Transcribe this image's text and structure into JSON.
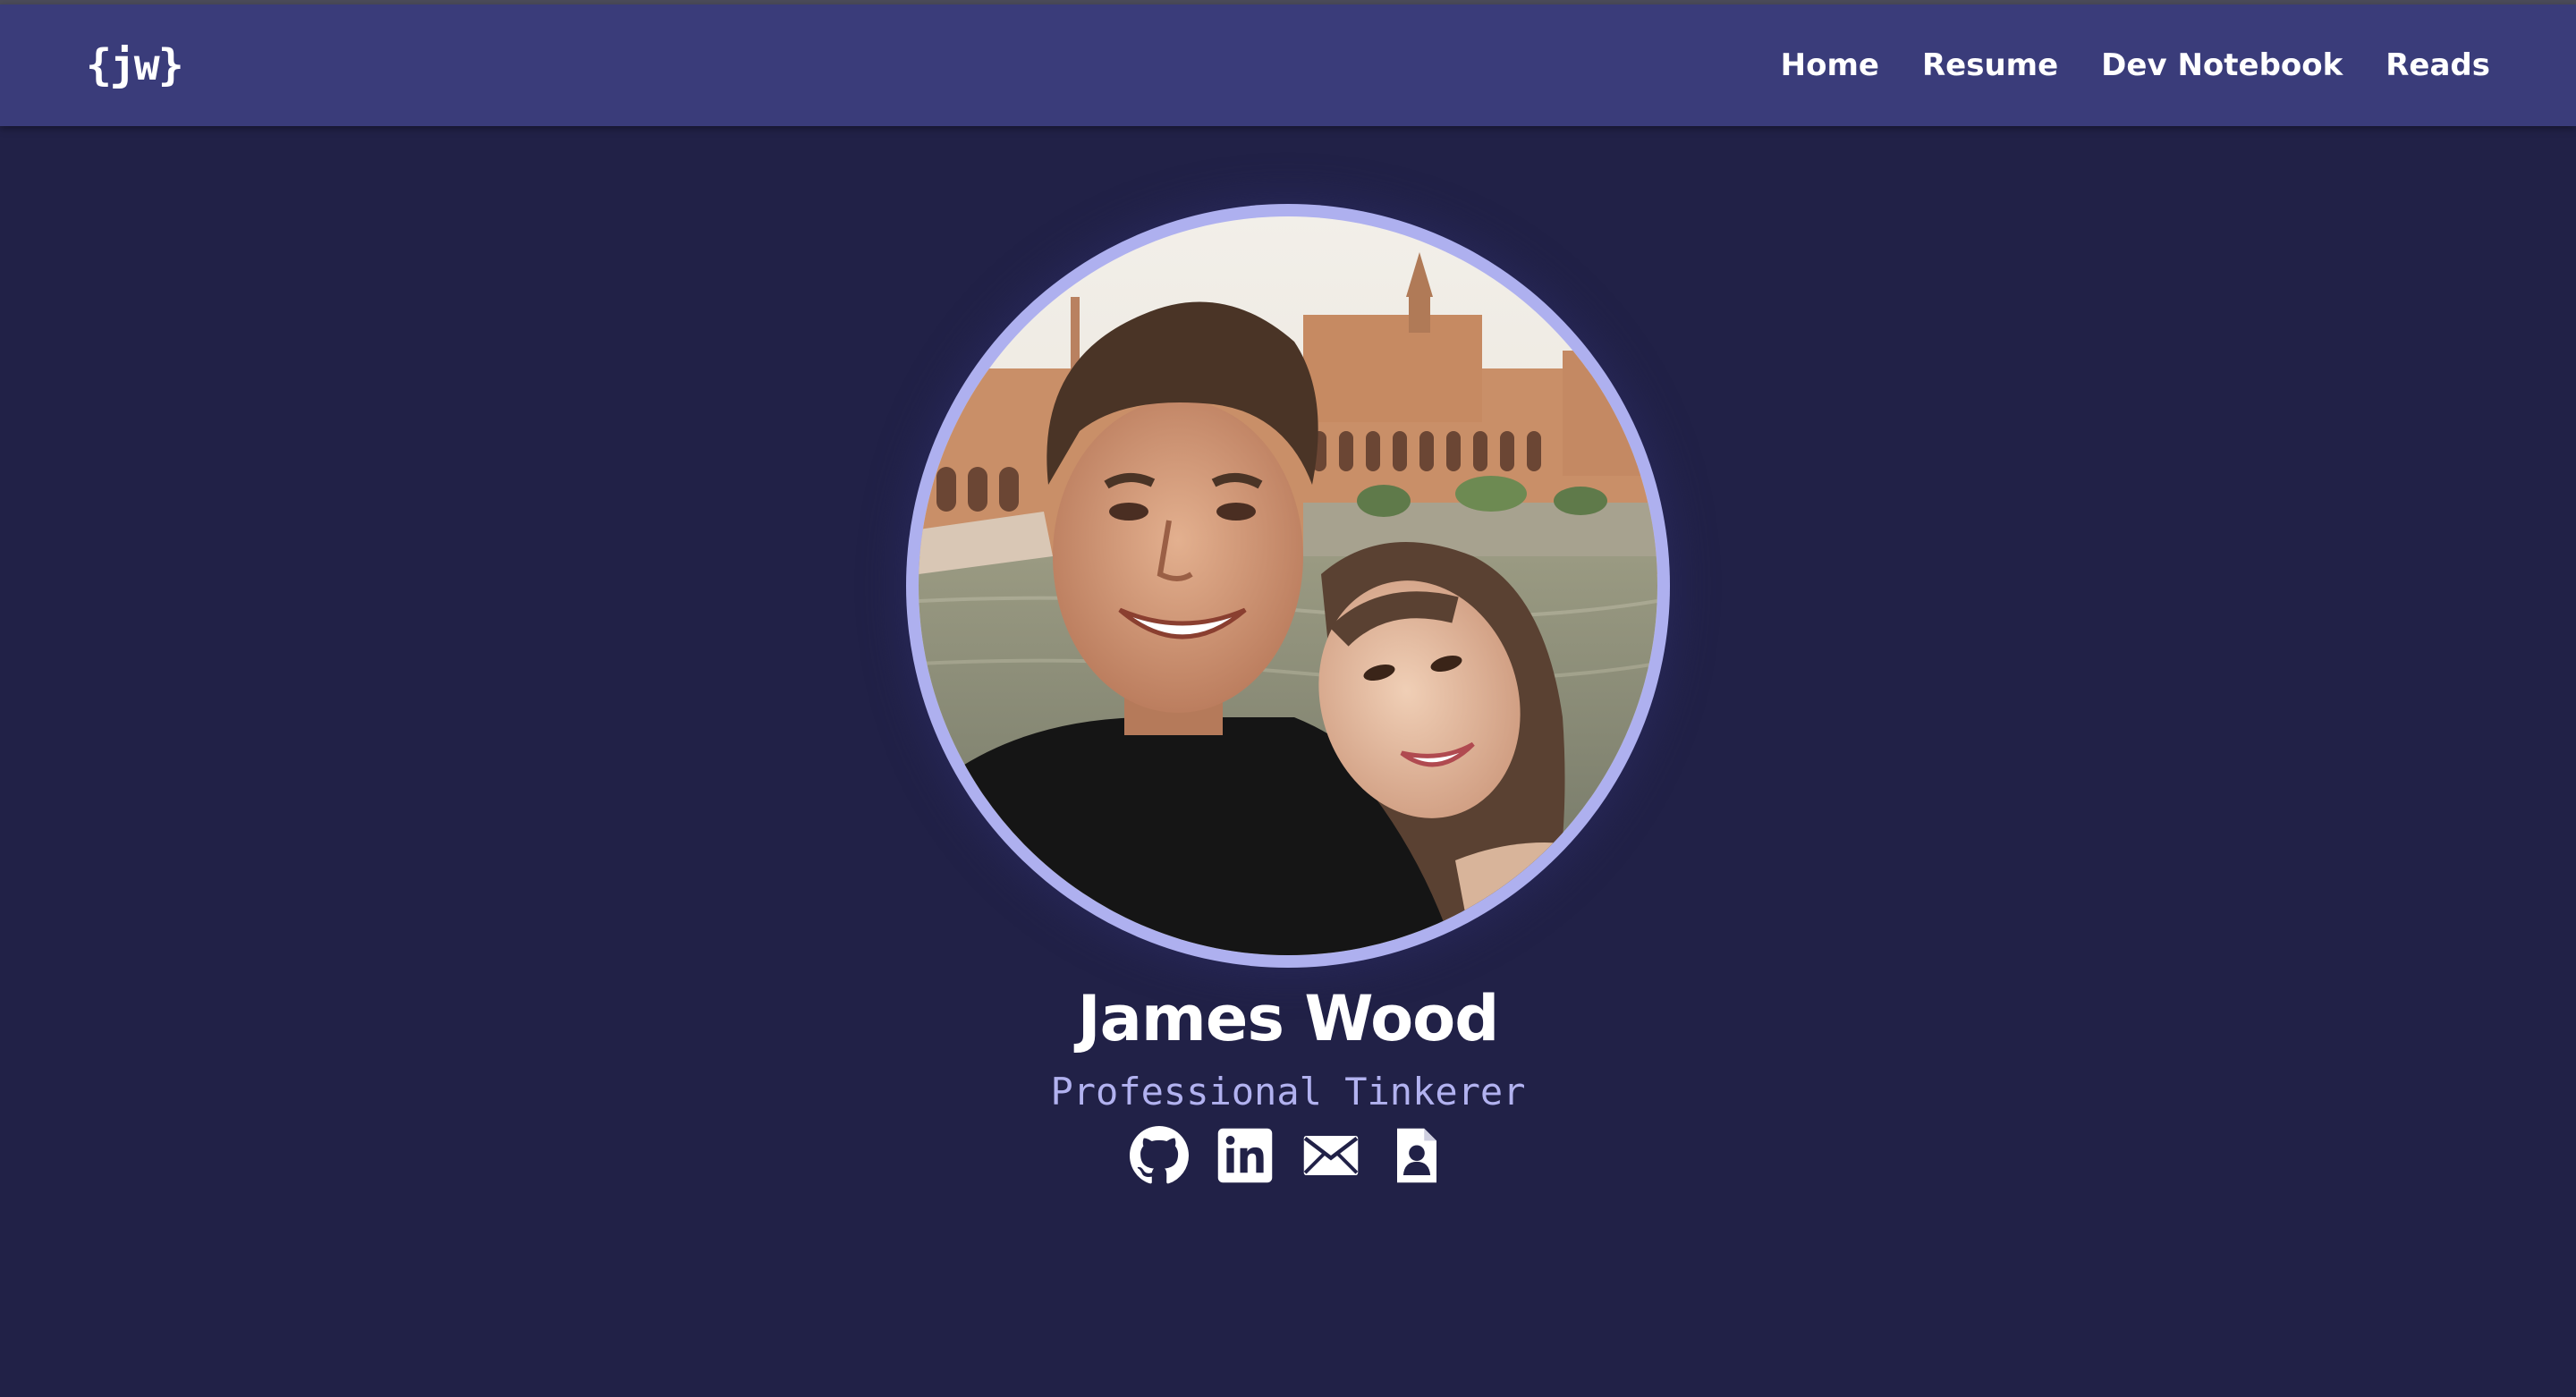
{
  "header": {
    "logo": "{jw}",
    "nav": [
      {
        "label": "Home"
      },
      {
        "label": "Resume"
      },
      {
        "label": "Dev Notebook"
      },
      {
        "label": "Reads"
      }
    ]
  },
  "profile": {
    "name": "James Wood",
    "tagline": "Professional Tinkerer",
    "photo_description": "Selfie of a smiling man and woman in front of Plaza de España",
    "socials": [
      {
        "icon": "github-icon"
      },
      {
        "icon": "linkedin-icon"
      },
      {
        "icon": "email-icon"
      },
      {
        "icon": "resume-contact-icon"
      }
    ]
  },
  "colors": {
    "background": "#212147",
    "navbar": "#3a3c7a",
    "accent_ring": "#aeb0ef",
    "tagline": "#b2b2f0",
    "text": "#ffffff"
  }
}
